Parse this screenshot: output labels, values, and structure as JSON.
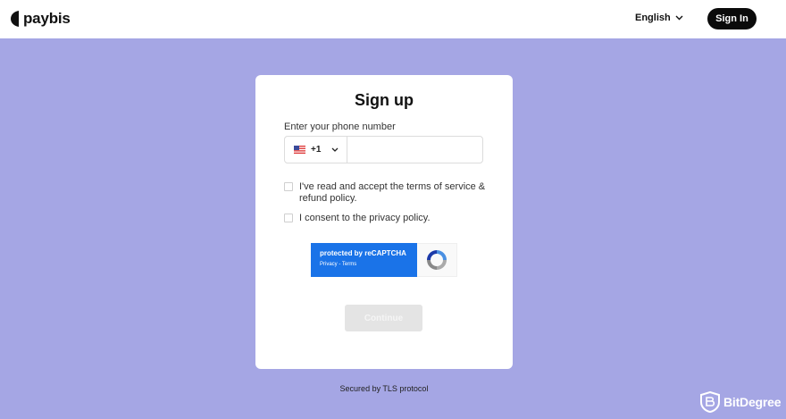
{
  "header": {
    "logo_text": "paybis",
    "language_label": "English",
    "signin_label": "Sign In"
  },
  "form": {
    "title": "Sign up",
    "phone_label": "Enter your phone number",
    "country_code": "+1",
    "country_flag": "us-flag-icon",
    "phone_value": "",
    "phone_placeholder": "",
    "terms_label": "I've read and accept the terms of service & refund policy.",
    "privacy_label": "I consent to the privacy policy.",
    "recaptcha_protected": "protected by reCAPTCHA",
    "recaptcha_links": "Privacy - Terms",
    "continue_label": "Continue"
  },
  "footer": {
    "secured_text": "Secured by TLS protocol",
    "watermark_text": "BitDegree"
  },
  "colors": {
    "background": "#a5a6e4",
    "header_bg": "#ffffff",
    "signin_bg": "#0b0b0b",
    "recaptcha_blue": "#1a73e8",
    "continue_disabled": "#e4e4e4"
  }
}
